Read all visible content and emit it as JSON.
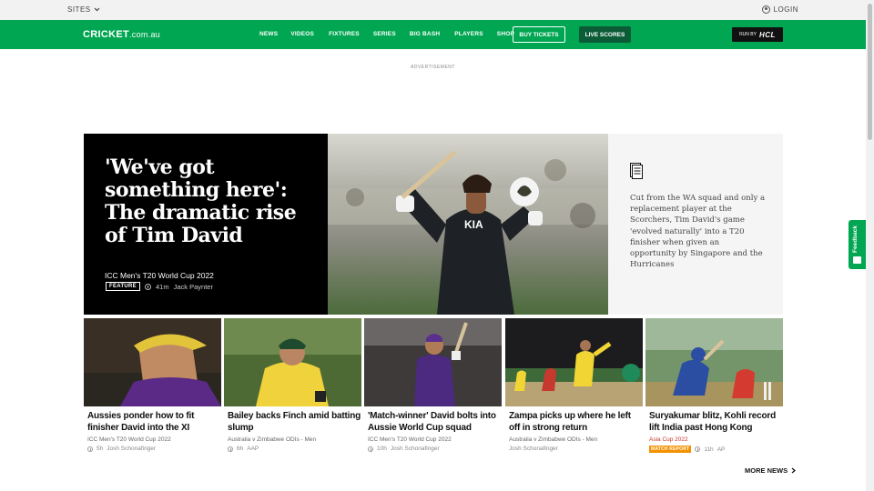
{
  "topbar": {
    "sites_label": "SITES",
    "login_label": "LOGIN"
  },
  "nav": {
    "logo_main": "CRICKET",
    "logo_suffix": ".com.au",
    "links": [
      "NEWS",
      "VIDEOS",
      "FIXTURES",
      "SERIES",
      "BIG BASH",
      "PLAYERS",
      "SHOP"
    ],
    "buy_tickets": "BUY TICKETS",
    "live_scores": "LIVE SCORES",
    "sponsor_prefix": "RUN BY",
    "sponsor_name": "HCL"
  },
  "ad_label": "ADVERTISEMENT",
  "hero": {
    "title": "'We've got something here': The dramatic rise of Tim David",
    "category": "ICC Men's T20 World Cup 2022",
    "badge": "FEATURE",
    "time": "41m",
    "author": "Jack Paynter",
    "description": "Cut from the WA squad and only a replacement player at the Scorchers, Tim David's game 'evolved naturally' into a T20 finisher when given an opportunity by Singapore and the Hurricanes"
  },
  "cards": [
    {
      "title": "Aussies ponder how to fit finisher David into the XI",
      "category": "ICC Men's T20 World Cup 2022",
      "time": "5h",
      "author": "Josh Schonafinger",
      "badge": ""
    },
    {
      "title": "Bailey backs Finch amid batting slump",
      "category": "Australia v Zimbabwe ODIs - Men",
      "time": "6h",
      "author": "AAP",
      "badge": ""
    },
    {
      "title": "'Match-winner' David bolts into Aussie World Cup squad",
      "category": "ICC Men's T20 World Cup 2022",
      "time": "10h",
      "author": "Josh Schonafinger",
      "badge": ""
    },
    {
      "title": "Zampa picks up where he left off in strong return",
      "category": "Australia v Zimbabwe ODIs - Men",
      "time": "",
      "author": "Josh Schonafinger",
      "badge": ""
    },
    {
      "title": "Suryakumar blitz, Kohli record lift India past Hong Kong",
      "category": "Asia Cup 2022",
      "time": "11h",
      "author": "AP",
      "badge": "MATCH REPORT"
    }
  ],
  "more_news": "MORE NEWS",
  "feedback_label": "Feedback",
  "colors": {
    "brand_green": "#00a651",
    "dark_green": "#0b5c36",
    "badge_orange": "#f39200"
  }
}
